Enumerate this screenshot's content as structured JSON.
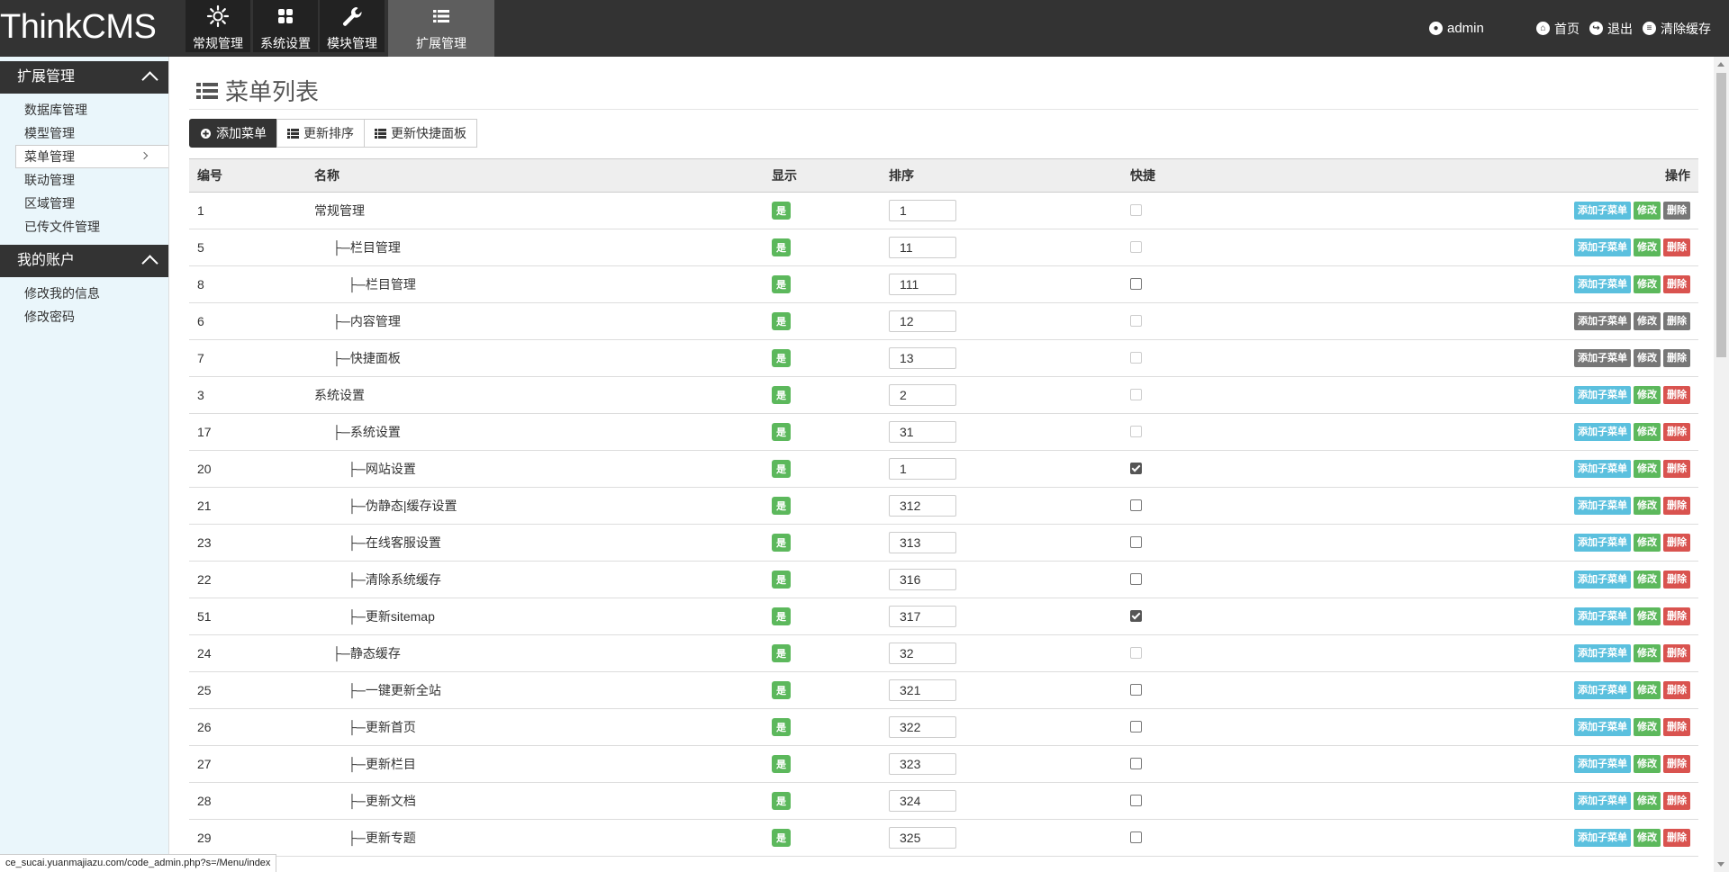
{
  "brand": "ThinkCMS",
  "nav": [
    {
      "label": "常规管理",
      "icon": "sun-icon"
    },
    {
      "label": "系统设置",
      "icon": "grid-icon"
    },
    {
      "label": "模块管理",
      "icon": "wrench-icon"
    },
    {
      "label": "扩展管理",
      "icon": "list-icon",
      "active": true
    }
  ],
  "top_right": {
    "user": "admin",
    "home": "首页",
    "logout": "退出",
    "clear_cache": "清除缓存"
  },
  "sidebar": {
    "groups": [
      {
        "title": "扩展管理",
        "items": [
          "数据库管理",
          "模型管理",
          "菜单管理",
          "联动管理",
          "区域管理",
          "已传文件管理"
        ],
        "active_index": 2
      },
      {
        "title": "我的账户",
        "items": [
          "修改我的信息",
          "修改密码"
        ]
      }
    ]
  },
  "page": {
    "title": "菜单列表",
    "buttons": [
      "添加菜单",
      "更新排序",
      "更新快捷面板"
    ]
  },
  "table": {
    "headers": [
      "编号",
      "名称",
      "显示",
      "排序",
      "快捷",
      "操作"
    ],
    "show_label": "是",
    "actions": [
      "添加子菜单",
      "修改",
      "删除"
    ],
    "rows": [
      {
        "id": "1",
        "name": "常规管理",
        "indent": 0,
        "sort": "1",
        "quick": "disabled",
        "style": "muted-delete"
      },
      {
        "id": "5",
        "name": "├─栏目管理",
        "indent": 1,
        "sort": "11",
        "quick": "disabled",
        "style": "normal"
      },
      {
        "id": "8",
        "name": "├─栏目管理",
        "indent": 2,
        "sort": "111",
        "quick": "unchecked",
        "style": "normal"
      },
      {
        "id": "6",
        "name": "├─内容管理",
        "indent": 1,
        "sort": "12",
        "quick": "disabled",
        "style": "muted"
      },
      {
        "id": "7",
        "name": "├─快捷面板",
        "indent": 1,
        "sort": "13",
        "quick": "disabled",
        "style": "muted"
      },
      {
        "id": "3",
        "name": "系统设置",
        "indent": 0,
        "sort": "2",
        "quick": "disabled",
        "style": "normal"
      },
      {
        "id": "17",
        "name": "├─系统设置",
        "indent": 1,
        "sort": "31",
        "quick": "disabled",
        "style": "normal"
      },
      {
        "id": "20",
        "name": "├─网站设置",
        "indent": 2,
        "sort": "1",
        "quick": "checked",
        "style": "normal"
      },
      {
        "id": "21",
        "name": "├─伪静态|缓存设置",
        "indent": 2,
        "sort": "312",
        "quick": "unchecked",
        "style": "normal"
      },
      {
        "id": "23",
        "name": "├─在线客服设置",
        "indent": 2,
        "sort": "313",
        "quick": "unchecked",
        "style": "normal"
      },
      {
        "id": "22",
        "name": "├─清除系统缓存",
        "indent": 2,
        "sort": "316",
        "quick": "unchecked",
        "style": "normal"
      },
      {
        "id": "51",
        "name": "├─更新sitemap",
        "indent": 2,
        "sort": "317",
        "quick": "checked",
        "style": "normal"
      },
      {
        "id": "24",
        "name": "├─静态缓存",
        "indent": 1,
        "sort": "32",
        "quick": "disabled",
        "style": "normal"
      },
      {
        "id": "25",
        "name": "├─一键更新全站",
        "indent": 2,
        "sort": "321",
        "quick": "unchecked",
        "style": "normal"
      },
      {
        "id": "26",
        "name": "├─更新首页",
        "indent": 2,
        "sort": "322",
        "quick": "unchecked",
        "style": "normal"
      },
      {
        "id": "27",
        "name": "├─更新栏目",
        "indent": 2,
        "sort": "323",
        "quick": "unchecked",
        "style": "normal"
      },
      {
        "id": "28",
        "name": "├─更新文档",
        "indent": 2,
        "sort": "324",
        "quick": "unchecked",
        "style": "normal"
      },
      {
        "id": "29",
        "name": "├─更新专题",
        "indent": 2,
        "sort": "325",
        "quick": "unchecked",
        "style": "normal"
      }
    ]
  },
  "status_url": "ce_sucai.yuanmajiazu.com/code_admin.php?s=/Menu/index"
}
